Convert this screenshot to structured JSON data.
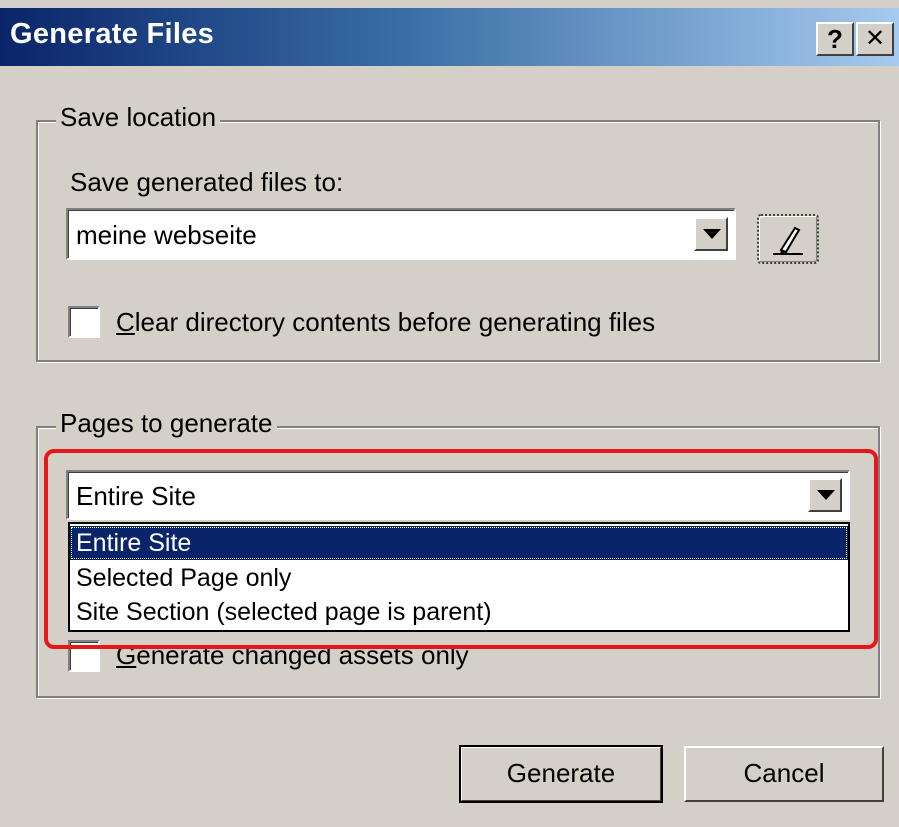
{
  "window": {
    "title": "Generate Files",
    "help_button": "?",
    "close_button": "✕"
  },
  "save_location": {
    "group_label": "Save location",
    "field_label": "Save generated files to:",
    "combo_value": "meine webseite",
    "clear_checkbox": {
      "mnemonic": "C",
      "label_rest": "lear directory contents before generating files",
      "checked": false
    }
  },
  "pages_to_generate": {
    "group_label": "Pages to generate",
    "combo_value": "Entire Site",
    "dropdown_options": [
      {
        "label": "Entire Site",
        "selected": true
      },
      {
        "label": "Selected Page only",
        "selected": false
      },
      {
        "label": "Site Section (selected page is parent)",
        "selected": false
      }
    ],
    "changed_assets_checkbox": {
      "mnemonic": "G",
      "label_rest": "enerate changed assets only",
      "checked": false
    }
  },
  "buttons": {
    "generate": "Generate",
    "cancel": "Cancel"
  },
  "icons": {
    "browse": "pencil-icon",
    "combo_arrow": "chevron-down-icon"
  },
  "colors": {
    "title_gradient_start": "#0a246a",
    "title_gradient_end": "#a6caf0",
    "dialog_face": "#d4d0c8",
    "selection": "#0a246a",
    "highlight_annotation": "#e8161b"
  }
}
